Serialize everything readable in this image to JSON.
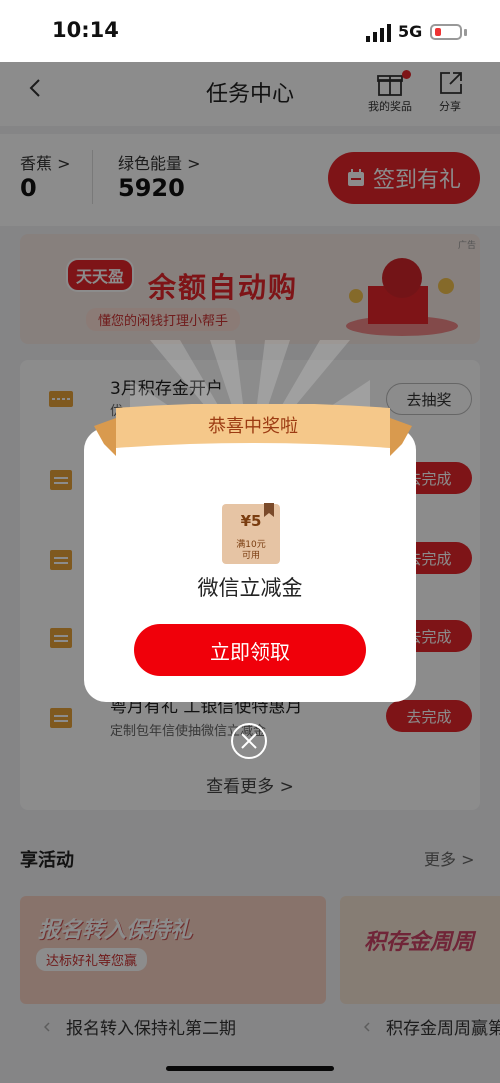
{
  "status_bar": {
    "time": "10:14",
    "network": "5G"
  },
  "header": {
    "title": "任务中心",
    "prize_label": "我的奖品",
    "share_label": "分享"
  },
  "stats": {
    "banana_label": "香蕉 >",
    "banana_value": "0",
    "energy_label": "绿色能量 >",
    "energy_value": "5920",
    "checkin_label": "签到有礼"
  },
  "banner": {
    "badge": "天天盈",
    "title": "余额自动购",
    "subtitle": "懂您的闲钱打理小帮手",
    "ad": "广告"
  },
  "tasks": [
    {
      "title": "3月积存金开户",
      "subtitle": "优",
      "button": "去抽奖"
    },
    {
      "title": "",
      "subtitle": "",
      "button": "去完成"
    },
    {
      "title": "",
      "subtitle": "",
      "button": "去完成"
    },
    {
      "title": "",
      "subtitle": "",
      "button": "去完成"
    },
    {
      "title": "粤月有礼 工银信使特惠月",
      "subtitle": "定制包年信使抽微信立减金",
      "button": "去完成"
    }
  ],
  "more_link": "查看更多 >",
  "activities": {
    "title": "享活动",
    "more": "更多 >",
    "cards": [
      {
        "banner_title": "报名转入保持礼",
        "banner_sub": "达标好礼等您赢",
        "caption": "报名转入保持礼第二期"
      },
      {
        "banner_title": "积存金周周",
        "caption": "积存金周周赢第"
      }
    ]
  },
  "modal": {
    "ribbon": "恭喜中奖啦",
    "coupon_value": "¥5",
    "coupon_condition": "满10元\n可用",
    "prize_name": "微信立减金",
    "claim_button": "立即领取"
  },
  "colors": {
    "accent": "#e5252a",
    "claim": "#f0000a",
    "ribbon": "#f5c88a"
  }
}
